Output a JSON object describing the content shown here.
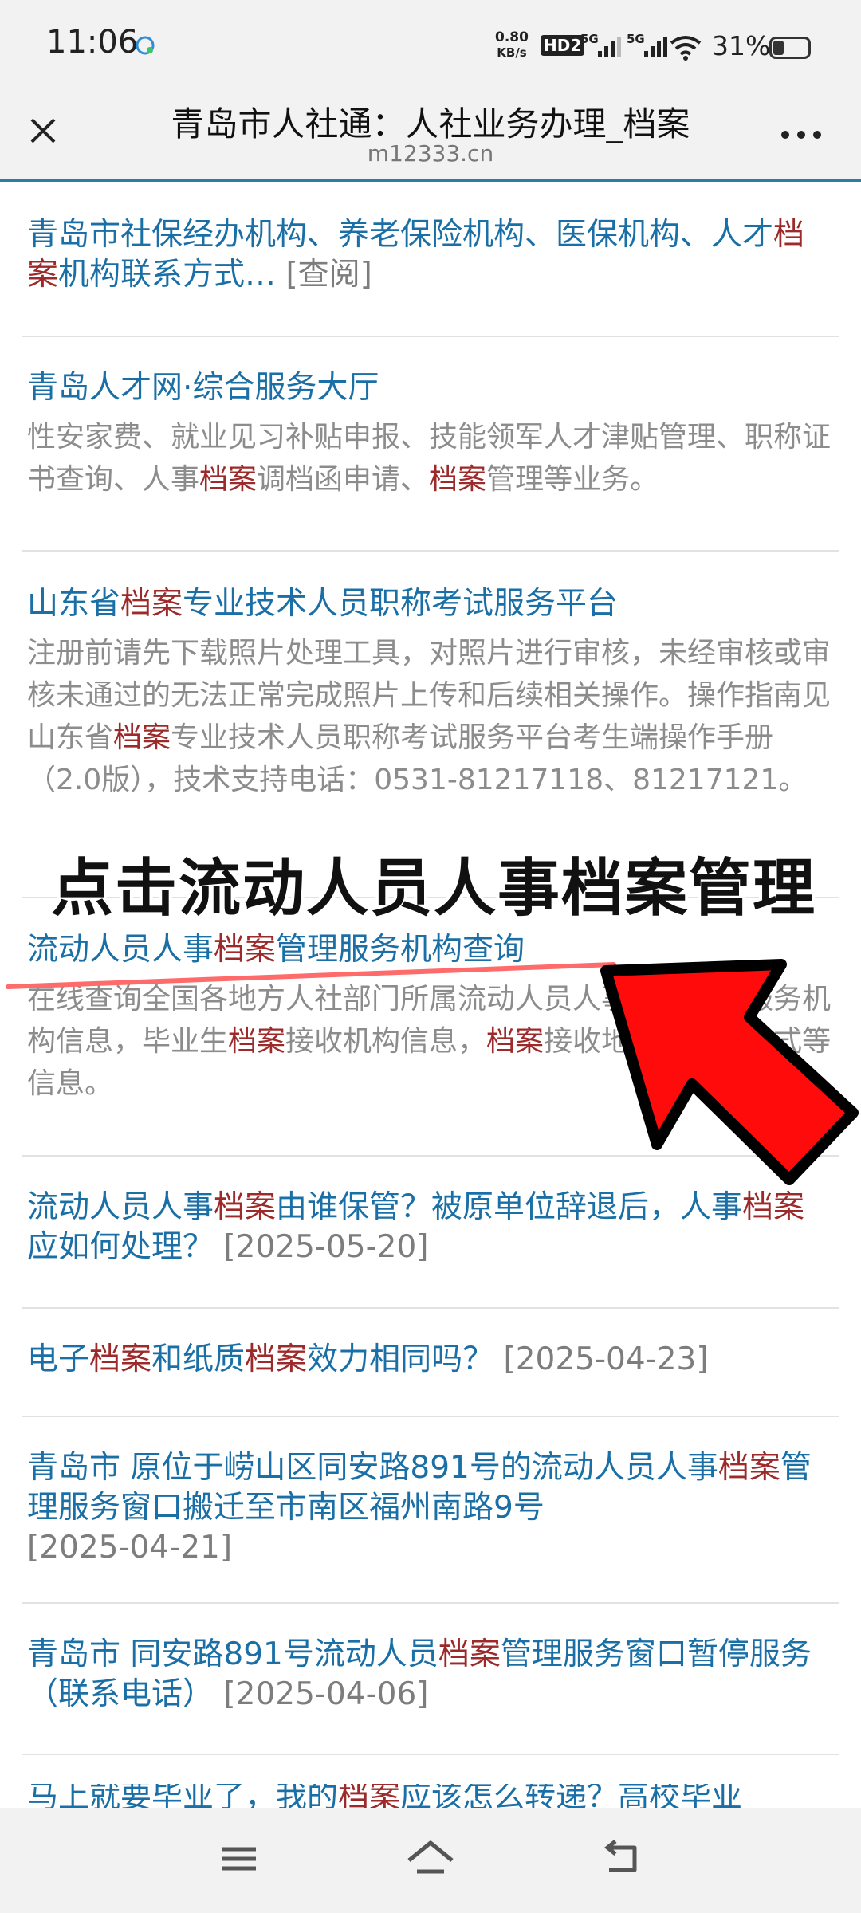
{
  "status_bar": {
    "time": "11:06",
    "net_speed_value": "0.80",
    "net_speed_unit": "KB/s",
    "hd_label": "HD2",
    "signal1_label": "5G",
    "signal2_label": "5G",
    "battery_percent": "31%",
    "battery_level": 0.31
  },
  "title_bar": {
    "title": "青岛市人社通：人社业务办理_档案",
    "url": "m12333.cn"
  },
  "results": [
    {
      "title_parts": [
        "青岛市社保经办机构、养老保险机构、医保机构、人才",
        "档案",
        "机构联系方式…"
      ],
      "date": "[查阅]"
    },
    {
      "title": "青岛人才网·综合服务大厅",
      "desc_parts": [
        "性安家费、就业见习补贴申报、技能领军人才津贴管理、职称证书查询、人事",
        "档案",
        "调档函申请、",
        "档案",
        "管理等业务。"
      ]
    },
    {
      "title_parts": [
        "山东省",
        "档案",
        "专业技术人员职称考试服务平台"
      ],
      "desc_parts": [
        "注册前请先下载照片处理工具，对照片进行审核，未经审核或审核未通过的无法正常完成照片上传和后续相关操作。操作指南见山东省",
        "档案",
        "专业技术人员职称考试服务平台考生端操作手册（2.0版），技术支持电话：0531-81217118、81217121。"
      ]
    },
    {
      "title_parts": [
        "流动人员人事",
        "档案",
        "管理服务机构查询"
      ],
      "desc_parts": [
        "在线查询全国各地方人社部门所属流动人员人事",
        "档案",
        "管理服务机构信息，毕业生",
        "档案",
        "接收机构信息，",
        "档案",
        "接收地址、联系方式等信息。"
      ]
    },
    {
      "title_parts": [
        "流动人员人事",
        "档案",
        "由谁保管？被原单位辞退后，人事",
        "档案",
        "应如何处理？"
      ],
      "date": "[2025-05-20]"
    },
    {
      "title_parts": [
        "电子",
        "档案",
        "和纸质",
        "档案",
        "效力相同吗？"
      ],
      "date": "[2025-04-23]"
    },
    {
      "title_parts": [
        "青岛市 原位于崂山区同安路891号的流动人员人事",
        "档案",
        "管理服务窗口搬迁至市南区福州南路9号"
      ],
      "date": "[2025-04-21]"
    },
    {
      "title_parts": [
        "青岛市 同安路891号流动人员",
        "档案",
        "管理服务窗口暂停服务（联系电话）"
      ],
      "date": "[2025-04-06]"
    },
    {
      "title_parts": [
        "马上就要毕业了，我的",
        "档案",
        "应该怎么转递？高校毕业"
      ]
    }
  ],
  "annotation": {
    "text": "点击流动人员人事档案管理",
    "highlight_color": "#ff0000"
  },
  "colors": {
    "link": "#1a6fa6",
    "keyword": "#9c2a2a",
    "desc": "#8c8c8c"
  }
}
